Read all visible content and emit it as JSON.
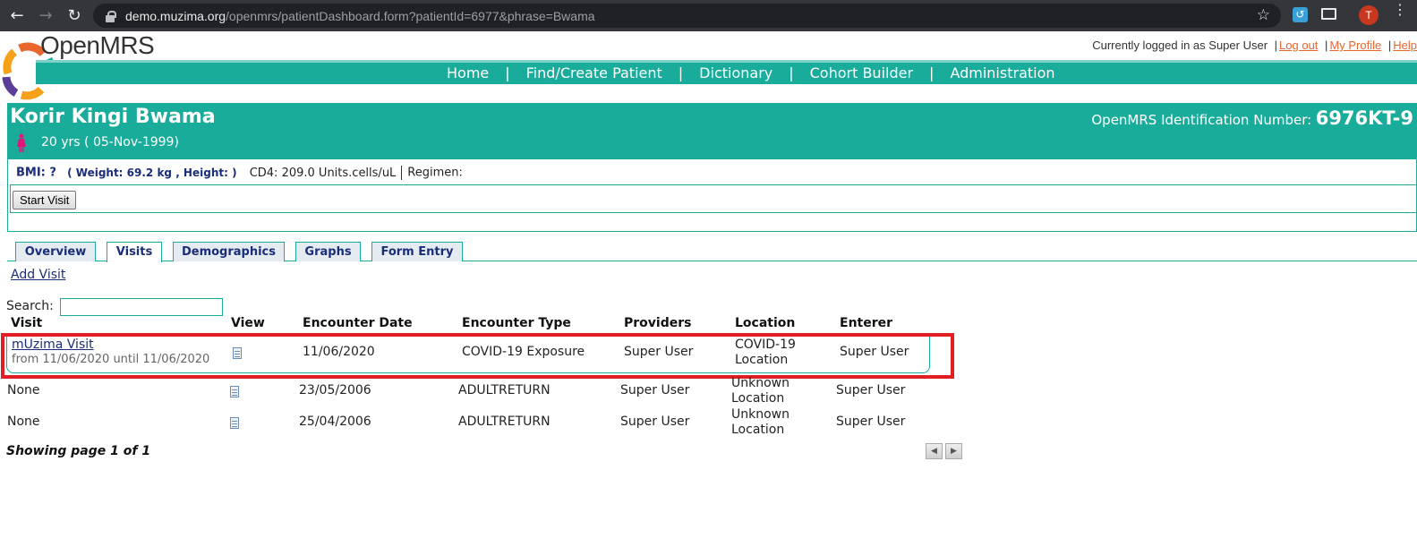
{
  "browser": {
    "url_host": "demo.muzima.org",
    "url_path": "/openmrs/patientDashboard.form?patientId=6977&phrase=Bwama",
    "avatar_letter": "T"
  },
  "app": {
    "logo_text": "OpenMRS",
    "logged_in_text": "Currently logged in as Super User",
    "logout": "Log out",
    "my_profile": "My Profile",
    "help": "Help",
    "nav": [
      "Home",
      "Find/Create Patient",
      "Dictionary",
      "Cohort Builder",
      "Administration"
    ],
    "colors": {
      "teal": "#1aac9b",
      "link_orange": "#e9662c",
      "navy": "#1a2d7a",
      "highlight_red": "#e01e24"
    }
  },
  "patient": {
    "name": "Korir Kingi Bwama",
    "age_dob": "20 yrs ( 05-Nov-1999)",
    "id_label": "OpenMRS Identification Number:",
    "id_value": "6976KT-9",
    "bmi": "BMI: ?",
    "weight_height": "( Weight: 69.2 kg , Height: )",
    "cd4": "CD4: 209.0 Units.cells/uL",
    "regimen": "Regimen:",
    "start_visit": "Start Visit"
  },
  "tabs": [
    "Overview",
    "Visits",
    "Demographics",
    "Graphs",
    "Form Entry"
  ],
  "active_tab": "Visits",
  "visits": {
    "add_visit": "Add Visit",
    "search_label": "Search:",
    "columns": [
      "Visit",
      "View",
      "Encounter Date",
      "Encounter Type",
      "Providers",
      "Location",
      "Enterer"
    ],
    "rows": [
      {
        "visit": "mUzima Visit",
        "visit_sub": "from 11/06/2020 until 11/06/2020",
        "date": "11/06/2020",
        "type": "COVID-19 Exposure",
        "providers": "Super User",
        "location": "COVID-19 Location",
        "enterer": "Super User"
      },
      {
        "visit": "None",
        "date": "23/05/2006",
        "type": "ADULTRETURN",
        "providers": "Super User",
        "location": "Unknown Location",
        "enterer": "Super User"
      },
      {
        "visit": "None",
        "date": "25/04/2006",
        "type": "ADULTRETURN",
        "providers": "Super User",
        "location": "Unknown Location",
        "enterer": "Super User"
      }
    ],
    "showing": "Showing page 1 of 1"
  }
}
